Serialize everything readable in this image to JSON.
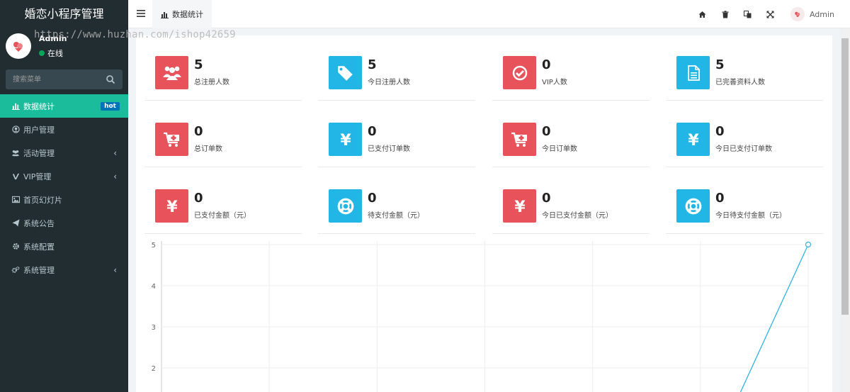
{
  "sidebar": {
    "brand": "婚恋小程序管理",
    "user": {
      "name": "Admin",
      "status": "在线"
    },
    "watermark": "https://www.huzhan.com/ishop42659",
    "search_placeholder": "搜索菜单",
    "items": [
      {
        "label": "数据统计",
        "icon": "bar-chart-icon",
        "badge": "hot",
        "active": true
      },
      {
        "label": "用户管理",
        "icon": "user-circle-icon"
      },
      {
        "label": "活动管理",
        "icon": "users-icon",
        "chevron": "‹"
      },
      {
        "label": "VIP管理",
        "icon": "vimeo-icon",
        "chevron": "‹"
      },
      {
        "label": "首页幻灯片",
        "icon": "image-icon"
      },
      {
        "label": "系统公告",
        "icon": "paper-plane-icon"
      },
      {
        "label": "系统配置",
        "icon": "gear-icon"
      },
      {
        "label": "系统管理",
        "icon": "gears-icon",
        "chevron": "‹"
      }
    ]
  },
  "header": {
    "tab_label": "数据统计",
    "admin_name": "Admin",
    "tools": [
      "home-icon",
      "trash-icon",
      "translate-icon",
      "fullscreen-icon"
    ]
  },
  "stats": [
    {
      "value": "5",
      "label": "总注册人数",
      "color": "red",
      "icon": "users-icon"
    },
    {
      "value": "5",
      "label": "今日注册人数",
      "color": "blue",
      "icon": "tags-icon"
    },
    {
      "value": "0",
      "label": "VIP人数",
      "color": "red",
      "icon": "check-circle-icon"
    },
    {
      "value": "5",
      "label": "已完善资料人数",
      "color": "blue",
      "icon": "file-text-icon"
    },
    {
      "value": "0",
      "label": "总订单数",
      "color": "red",
      "icon": "cart-plus-icon"
    },
    {
      "value": "0",
      "label": "已支付订单数",
      "color": "blue",
      "icon": "yen-icon"
    },
    {
      "value": "0",
      "label": "今日订单数",
      "color": "red",
      "icon": "cart-plus-icon"
    },
    {
      "value": "0",
      "label": "今日已支付订单数",
      "color": "blue",
      "icon": "yen-icon"
    },
    {
      "value": "0",
      "label": "已支付金额（元）",
      "color": "red",
      "icon": "yen-icon"
    },
    {
      "value": "0",
      "label": "待支付金额（元）",
      "color": "blue",
      "icon": "life-ring-icon"
    },
    {
      "value": "0",
      "label": "今日已支付金额（元）",
      "color": "red",
      "icon": "yen-icon"
    },
    {
      "value": "0",
      "label": "今日待支付金额（元）",
      "color": "blue",
      "icon": "life-ring-icon"
    }
  ],
  "colors": {
    "red": "#e8525a",
    "blue": "#21b6e5",
    "accent": "#1abc9c",
    "sidebar": "#222d32",
    "line": "#2fb4e0"
  },
  "chart_data": {
    "type": "line",
    "title": "",
    "xlabel": "",
    "ylabel": "",
    "yticks": [
      "5",
      "4",
      "3",
      "2"
    ],
    "ylim": [
      1,
      5
    ],
    "grid": true,
    "series": [
      {
        "points": [
          [
            5.3,
            1
          ],
          [
            6,
            5
          ]
        ]
      }
    ],
    "xlim": [
      0,
      6
    ]
  }
}
